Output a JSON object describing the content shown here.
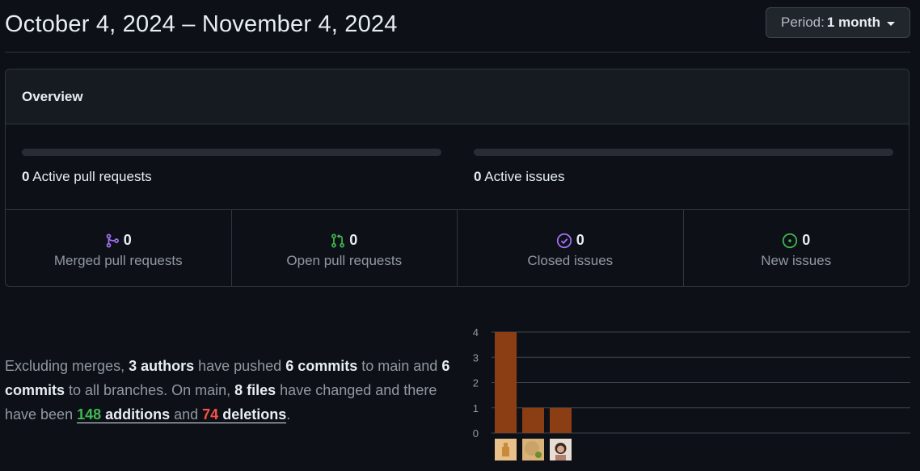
{
  "header": {
    "title": "October 4, 2024 – November 4, 2024",
    "period_label": "Period:",
    "period_value": "1 month"
  },
  "overview": {
    "title": "Overview",
    "pull_requests": {
      "count": "0",
      "label": "Active pull requests",
      "fraction": 0
    },
    "issues": {
      "count": "0",
      "label": "Active issues",
      "fraction": 0
    },
    "stats": [
      {
        "icon": "merged-pr-icon",
        "color": "#a371f7",
        "count": "0",
        "label": "Merged pull requests"
      },
      {
        "icon": "open-pr-icon",
        "color": "#3fb950",
        "count": "0",
        "label": "Open pull requests"
      },
      {
        "icon": "closed-issue-icon",
        "color": "#a371f7",
        "count": "0",
        "label": "Closed issues"
      },
      {
        "icon": "new-issue-icon",
        "color": "#3fb950",
        "count": "0",
        "label": "New issues"
      }
    ]
  },
  "summary": {
    "t1": "Excluding merges, ",
    "authors": "3 authors",
    "t2": " have pushed ",
    "commits_main": "6 commits",
    "t3": " to main and ",
    "commits_all": "6 commits",
    "t4": " to all branches. On main, ",
    "files": "8 files",
    "t5": " have changed and there have been ",
    "additions_num": "148",
    "additions_word": " additions",
    "and": " and ",
    "deletions_num": "74",
    "deletions_word": " deletions",
    "end": "."
  },
  "chart_data": {
    "type": "bar",
    "categories": [
      "author-1",
      "author-2",
      "author-3"
    ],
    "values": [
      4,
      1,
      1
    ],
    "ylim": [
      0,
      4
    ],
    "yticks": [
      "0",
      "1",
      "2",
      "3",
      "4"
    ],
    "grid": true,
    "bar_color": "#8b3d14"
  }
}
